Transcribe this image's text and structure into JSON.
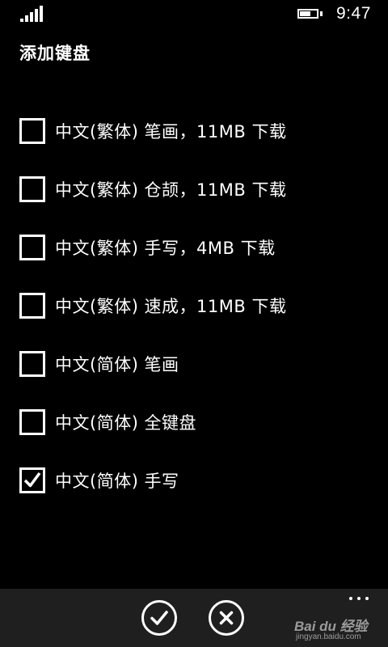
{
  "status_bar": {
    "time": "9:47",
    "signal_icon": "signal-bars-icon",
    "battery_icon": "battery-icon",
    "battery_level": 0.65
  },
  "page": {
    "title": "添加键盘"
  },
  "keyboards": [
    {
      "label": "中文(繁体) 笔画，11MB 下载",
      "checked": false
    },
    {
      "label": "中文(繁体) 仓颉，11MB 下载",
      "checked": false
    },
    {
      "label": "中文(繁体) 手写，4MB 下载",
      "checked": false
    },
    {
      "label": "中文(繁体) 速成，11MB 下载",
      "checked": false
    },
    {
      "label": "中文(简体) 笔画",
      "checked": false
    },
    {
      "label": "中文(简体) 全键盘",
      "checked": false
    },
    {
      "label": "中文(简体) 手写",
      "checked": true
    }
  ],
  "app_bar": {
    "confirm_icon": "check-circle-icon",
    "cancel_icon": "close-circle-icon",
    "more_icon": "more-dots-icon"
  },
  "watermark": {
    "brand": "Bai du 经验",
    "sub": "jingyan.baidu.com"
  }
}
